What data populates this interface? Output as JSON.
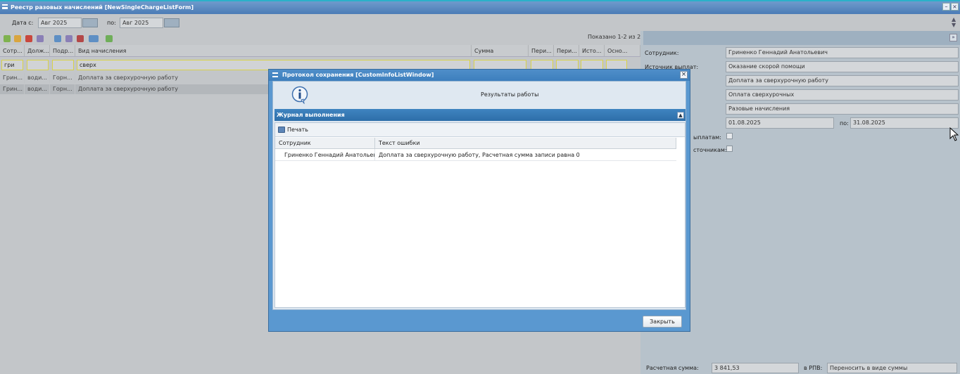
{
  "main_window": {
    "title": "Реестр разовых начислений [NewSingleChargeListForm]"
  },
  "date_filter": {
    "from_label": "Дата с:",
    "from_value": "Авг 2025",
    "to_label": "по:",
    "to_value": "Авг 2025"
  },
  "grid": {
    "shown_text": "Показано 1-2 из 2",
    "columns": [
      "Сотр...",
      "Долж...",
      "Подр...",
      "Вид начисления",
      "Сумма",
      "Пери...",
      "Пери...",
      "Исто...",
      "Осно..."
    ],
    "filters": {
      "employee": "гри",
      "charge_type": "сверх"
    },
    "rows": [
      [
        "Грин...",
        "води...",
        "Горн...",
        "Доплата за сверхурочную работу"
      ],
      [
        "Грин...",
        "води...",
        "Горн...",
        "Доплата за сверхурочную работу"
      ]
    ]
  },
  "details": {
    "employee_label": "Сотрудник:",
    "employee_value": "Гриненко Геннадий Анатольевич",
    "source_label": "Источник выплат:",
    "source_value": "Оказание скорой помощи",
    "charge_value": "Доплата за сверхурочную работу",
    "basis_value": "Оплата сверхурочных",
    "kind_value": "Разовые начисления",
    "period_from": "01.08.2025",
    "period_to_label": "по:",
    "period_to": "31.08.2025",
    "check1_label": "ыплатам:",
    "check2_label": "сточникам:",
    "calc_label": "Расчетная сумма:",
    "calc_value": "3 841,53",
    "rpv_label": "в РПВ:",
    "rpv_value": "Переносить в виде суммы"
  },
  "modal": {
    "title": "Протокол сохранения [CustomInfoListWindow]",
    "results_text": "Результаты работы",
    "section_title": "Журнал выполнения",
    "print_label": "Печать",
    "columns": [
      "Сотрудник",
      "Текст ошибки"
    ],
    "rows": [
      [
        "Гриненко Геннадий Анатольевич",
        "Доплата за сверхурочную работу, Расчетная сумма записи равна 0"
      ]
    ],
    "close_label": "Закрыть"
  }
}
